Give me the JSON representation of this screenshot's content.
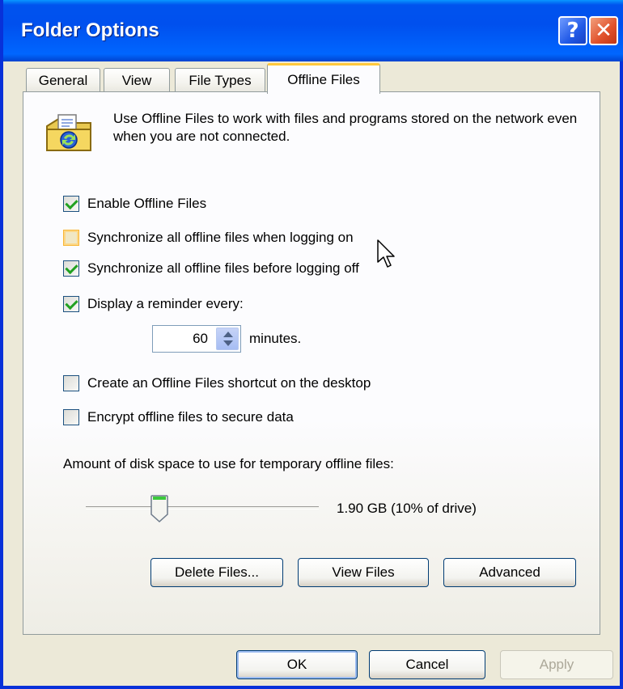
{
  "window": {
    "title": "Folder Options",
    "help_label": "?",
    "close_label": "✕"
  },
  "tabs": [
    {
      "label": "General",
      "active": false
    },
    {
      "label": "View",
      "active": false
    },
    {
      "label": "File Types",
      "active": false
    },
    {
      "label": "Offline Files",
      "active": true
    }
  ],
  "intro_text": "Use Offline Files to work with files and programs stored on the network even when you are not connected.",
  "options": {
    "enable_offline": {
      "label": "Enable Offline Files",
      "checked": true
    },
    "sync_logon": {
      "label": "Synchronize all offline files when logging on",
      "checked": false
    },
    "sync_logoff": {
      "label": "Synchronize all offline files before logging off",
      "checked": true
    },
    "reminder": {
      "label": "Display a reminder every:",
      "checked": true
    },
    "shortcut": {
      "label": "Create an Offline Files shortcut on the desktop",
      "checked": false
    },
    "encrypt": {
      "label": "Encrypt offline files to secure data",
      "checked": false
    }
  },
  "reminder_interval": {
    "value": "60",
    "unit": "minutes."
  },
  "disk_space": {
    "label": "Amount of disk space to use for temporary offline files:",
    "value_text": "1.90 GB (10% of drive)",
    "percent": 10
  },
  "actions": {
    "delete_label": "Delete Files...",
    "view_label": "View Files",
    "advanced_label": "Advanced"
  },
  "dialog_buttons": {
    "ok_label": "OK",
    "cancel_label": "Cancel",
    "apply_label": "Apply"
  },
  "icons": {
    "offline": "offline-files-icon",
    "cursor": "mouse-pointer-icon"
  },
  "colors": {
    "titlebar": "#0053ee",
    "face": "#ece9d8",
    "check": "#21a121",
    "active_tab_accent": "#ffc83c"
  }
}
